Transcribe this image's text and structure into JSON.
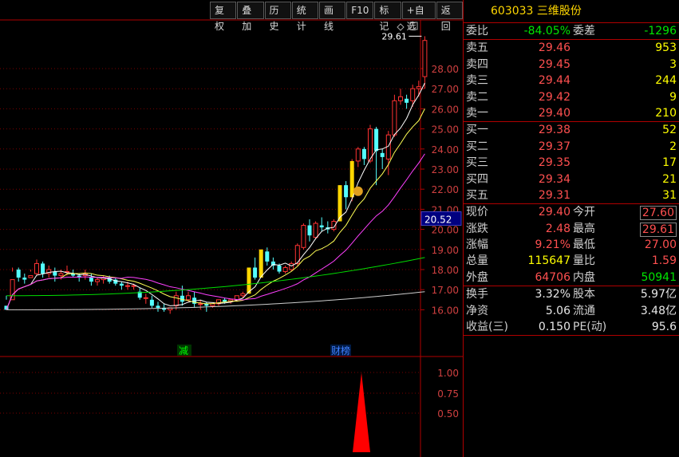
{
  "toolbar": [
    {
      "name": "tb-fuquan",
      "label": "复权"
    },
    {
      "name": "tb-diejia",
      "label": "叠加"
    },
    {
      "name": "tb-lishi",
      "label": "历史"
    },
    {
      "name": "tb-tongji",
      "label": "统计"
    },
    {
      "name": "tb-huaxian",
      "label": "画线"
    },
    {
      "name": "tb-f10",
      "label": "F10"
    },
    {
      "name": "tb-biaoji",
      "label": "标记"
    },
    {
      "name": "tb-zixuan",
      "label": "+自选"
    },
    {
      "name": "tb-fanhui",
      "label": "返回"
    }
  ],
  "stock": {
    "code": "603033",
    "name": "三维股份"
  },
  "weibi": {
    "label1": "委比",
    "value1": "-84.05%",
    "label2": "委差",
    "value2": "-1296"
  },
  "asks": [
    {
      "label": "卖五",
      "price": "29.46",
      "vol": "953"
    },
    {
      "label": "卖四",
      "price": "29.45",
      "vol": "3"
    },
    {
      "label": "卖三",
      "price": "29.44",
      "vol": "244"
    },
    {
      "label": "卖二",
      "price": "29.42",
      "vol": "9"
    },
    {
      "label": "卖一",
      "price": "29.40",
      "vol": "210"
    }
  ],
  "bids": [
    {
      "label": "买一",
      "price": "29.38",
      "vol": "52"
    },
    {
      "label": "买二",
      "price": "29.37",
      "vol": "2"
    },
    {
      "label": "买三",
      "price": "29.35",
      "vol": "17"
    },
    {
      "label": "买四",
      "price": "29.34",
      "vol": "21"
    },
    {
      "label": "买五",
      "price": "29.31",
      "vol": "31"
    }
  ],
  "stats1": [
    {
      "l1": "现价",
      "v1": "29.40",
      "c1": "red",
      "l2": "今开",
      "v2": "27.60",
      "c2": "red"
    },
    {
      "l1": "涨跌",
      "v1": "2.48",
      "c1": "red",
      "l2": "最高",
      "v2": "29.61",
      "c2": "red"
    },
    {
      "l1": "涨幅",
      "v1": "9.21%",
      "c1": "red",
      "l2": "最低",
      "v2": "27.00",
      "c2": "red"
    },
    {
      "l1": "总量",
      "v1": "115647",
      "c1": "yellow",
      "l2": "量比",
      "v2": "1.59",
      "c2": "red"
    },
    {
      "l1": "外盘",
      "v1": "64706",
      "c1": "red",
      "l2": "内盘",
      "v2": "50941",
      "c2": "green"
    }
  ],
  "stats2": [
    {
      "l1": "换手",
      "v1": "3.32%",
      "l2": "股本",
      "v2": "5.97亿"
    },
    {
      "l1": "净资",
      "v1": "5.06",
      "l2": "流通",
      "v2": "3.48亿"
    },
    {
      "l1": "收益(三)",
      "v1": "0.150",
      "l2": "PE(动)",
      "v2": "95.6"
    }
  ],
  "chart": {
    "price_ticks": [
      "28.00",
      "27.00",
      "26.00",
      "25.00",
      "24.00",
      "23.00",
      "22.00",
      "21.00",
      "20.00",
      "19.00",
      "18.00",
      "17.00",
      "16.00"
    ],
    "ind_ticks": [
      "1.00",
      "0.75",
      "0.50"
    ],
    "high_label": "29.61",
    "cursor_price": "20.52",
    "markers": {
      "jian": "减",
      "caibang": "财榜"
    },
    "colors": {
      "up": "#ff3232",
      "down": "#54ffff",
      "limit": "#ffd700",
      "ma5": "#ffffff",
      "ma10": "#ffff55",
      "ma20": "#ff40ff",
      "ma60": "#00dd00",
      "ma120": "#cccccc",
      "signal": "#ff0000"
    }
  },
  "candles": [
    [
      16.2,
      16.5,
      16.0,
      16.7
    ],
    [
      16.5,
      17.9,
      17.5,
      18.1
    ],
    [
      18.0,
      18.1,
      17.6,
      17.4
    ],
    [
      17.6,
      17.8,
      17.5,
      17.3
    ],
    [
      17.6,
      18.0,
      17.7,
      17.9
    ],
    [
      17.8,
      18.5,
      18.3,
      17.7
    ],
    [
      18.3,
      18.4,
      17.8,
      17.6
    ],
    [
      17.8,
      18.2,
      18.0,
      17.6
    ],
    [
      17.9,
      18.1,
      17.7,
      17.4
    ],
    [
      17.7,
      18.0,
      17.8,
      17.5
    ],
    [
      17.9,
      18.2,
      17.9,
      17.7
    ],
    [
      17.8,
      18.0,
      17.7,
      17.6
    ],
    [
      17.7,
      17.8,
      17.6,
      17.4
    ],
    [
      17.7,
      18.0,
      17.8,
      17.5
    ],
    [
      17.6,
      17.8,
      17.4,
      17.2
    ],
    [
      17.4,
      17.6,
      17.5,
      17.2
    ],
    [
      17.5,
      17.7,
      17.6,
      17.3
    ],
    [
      17.6,
      17.7,
      17.4,
      17.3
    ],
    [
      17.5,
      17.6,
      17.3,
      17.2
    ],
    [
      17.3,
      17.4,
      17.2,
      17.0
    ],
    [
      17.2,
      17.4,
      17.2,
      17.0
    ],
    [
      17.2,
      17.3,
      17.2,
      17.0
    ],
    [
      16.9,
      17.1,
      16.6,
      16.5
    ],
    [
      16.6,
      16.8,
      16.6,
      16.3
    ],
    [
      16.5,
      16.7,
      16.2,
      16.1
    ],
    [
      16.2,
      16.4,
      16.1,
      15.9
    ],
    [
      16.1,
      16.3,
      16.0,
      15.9
    ],
    [
      16.0,
      16.1,
      16.1,
      15.8
    ],
    [
      16.2,
      16.9,
      16.7,
      16.0
    ],
    [
      16.7,
      17.2,
      16.4,
      16.2
    ],
    [
      16.5,
      16.9,
      16.7,
      16.4
    ],
    [
      16.6,
      16.9,
      16.3,
      16.1
    ],
    [
      16.3,
      16.5,
      16.3,
      16.0
    ],
    [
      16.3,
      16.4,
      16.2,
      15.9
    ],
    [
      16.2,
      16.3,
      16.3,
      16.1
    ],
    [
      16.3,
      16.5,
      16.5,
      16.2
    ],
    [
      16.5,
      16.6,
      16.4,
      16.3
    ],
    [
      16.4,
      16.5,
      16.5,
      16.3
    ],
    [
      16.5,
      16.6,
      16.7,
      16.4
    ],
    [
      16.7,
      16.9,
      16.8,
      16.6
    ],
    [
      16.8,
      18.1,
      18.1,
      16.8
    ],
    [
      18.1,
      18.6,
      17.6,
      17.5
    ],
    [
      17.6,
      19.0,
      19.0,
      17.6
    ],
    [
      18.9,
      19.1,
      18.4,
      18.2
    ],
    [
      18.4,
      18.6,
      18.2,
      18.0
    ],
    [
      18.2,
      18.3,
      17.9,
      17.8
    ],
    [
      17.9,
      18.2,
      18.1,
      17.8
    ],
    [
      18.0,
      18.4,
      18.3,
      17.9
    ],
    [
      18.3,
      19.3,
      19.2,
      18.2
    ],
    [
      19.1,
      20.3,
      20.2,
      19.0
    ],
    [
      20.2,
      20.5,
      19.7,
      19.4
    ],
    [
      19.6,
      20.4,
      20.3,
      19.5
    ],
    [
      20.2,
      20.6,
      20.1,
      19.9
    ],
    [
      20.1,
      20.4,
      20.0,
      19.8
    ],
    [
      20.0,
      20.5,
      20.4,
      19.9
    ],
    [
      20.4,
      22.2,
      22.2,
      20.4
    ],
    [
      22.2,
      22.4,
      21.6,
      21.0
    ],
    [
      21.6,
      23.5,
      23.4,
      21.4
    ],
    [
      23.4,
      24.1,
      24.0,
      23.1
    ],
    [
      24.0,
      24.1,
      23.5,
      23.2
    ],
    [
      23.4,
      25.2,
      25.0,
      23.3
    ],
    [
      25.0,
      25.1,
      23.9,
      22.2
    ],
    [
      23.8,
      24.0,
      23.6,
      23.0
    ],
    [
      23.5,
      24.9,
      24.7,
      22.7
    ],
    [
      24.7,
      26.7,
      26.4,
      24.6
    ],
    [
      26.4,
      27.0,
      26.6,
      26.2
    ],
    [
      26.5,
      26.7,
      26.3,
      26.0
    ],
    [
      26.4,
      27.2,
      27.0,
      26.1
    ],
    [
      27.0,
      27.4,
      27.1,
      26.6
    ],
    [
      27.6,
      29.61,
      29.4,
      27.0
    ]
  ]
}
